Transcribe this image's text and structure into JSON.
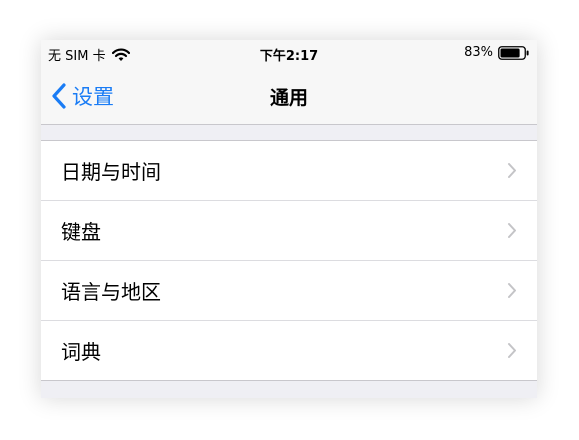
{
  "status_bar": {
    "carrier": "无 SIM 卡",
    "time": "下午2:17",
    "battery_percent": "83%",
    "battery_level": 0.83
  },
  "nav": {
    "back_label": "设置",
    "title": "通用"
  },
  "settings": [
    {
      "label": "日期与时间"
    },
    {
      "label": "键盘"
    },
    {
      "label": "语言与地区"
    },
    {
      "label": "词典"
    }
  ],
  "colors": {
    "accent": "#1a7cf5",
    "background": "#efeff4",
    "bar": "#f7f7f7",
    "chevron": "#c4c4c7"
  }
}
